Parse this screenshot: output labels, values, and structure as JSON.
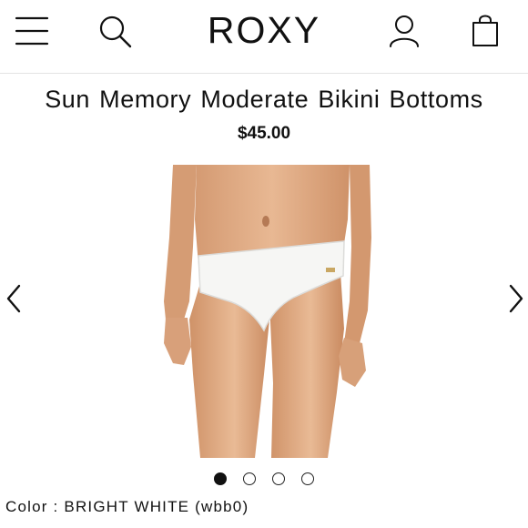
{
  "header": {
    "brand": "ROXY",
    "icons": [
      "menu-icon",
      "search-icon",
      "account-icon",
      "shopping-bag-icon"
    ]
  },
  "product": {
    "title": "Sun Memory Moderate Bikini Bottoms",
    "price": "$45.00",
    "image_alt": "",
    "color_label": "Color",
    "color_separator": " : ",
    "color_value": "BRIGHT WHITE (wbb0)"
  },
  "gallery": {
    "slide_count": 4,
    "active_index": 0
  },
  "colors": {
    "text": "#111111",
    "divider": "#e3e3e3",
    "background": "#ffffff"
  }
}
